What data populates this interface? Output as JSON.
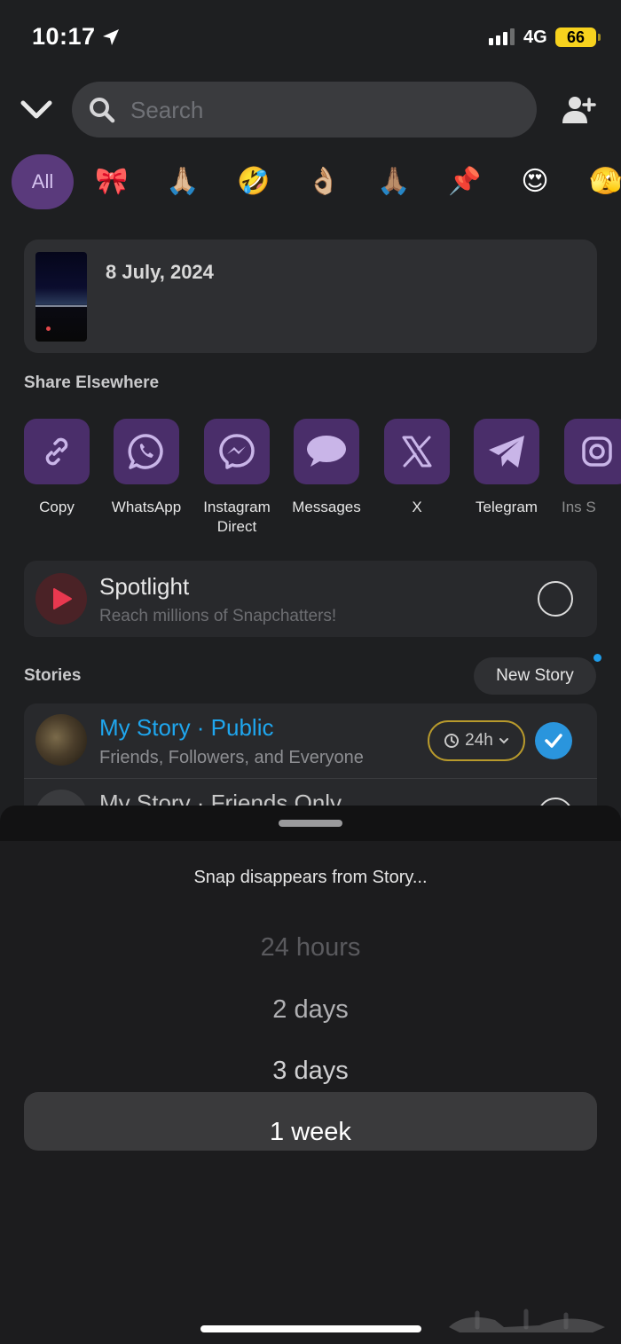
{
  "status_bar": {
    "time": "10:17",
    "network": "4G",
    "battery": "66"
  },
  "search": {
    "placeholder": "Search"
  },
  "filters": {
    "all_label": "All",
    "emojis": [
      "🎀",
      "🙏🏼",
      "🤣",
      "👌🏼",
      "🙏🏽",
      "📌",
      "😍",
      "🫣"
    ]
  },
  "snap": {
    "date": "8 July, 2024"
  },
  "share_elsewhere": {
    "title": "Share Elsewhere",
    "items": [
      {
        "label": "Copy",
        "icon": "link-icon"
      },
      {
        "label": "WhatsApp",
        "icon": "whatsapp-icon"
      },
      {
        "label": "Instagram Direct",
        "icon": "messenger-icon"
      },
      {
        "label": "Messages",
        "icon": "speech-bubble-icon"
      },
      {
        "label": "X",
        "icon": "x-icon"
      },
      {
        "label": "Telegram",
        "icon": "paper-plane-icon"
      },
      {
        "label": "Ins S",
        "icon": "instagram-icon"
      }
    ]
  },
  "spotlight": {
    "title": "Spotlight",
    "subtitle": "Reach millions of Snapchatters!"
  },
  "stories": {
    "title": "Stories",
    "new_story_label": "New Story",
    "items": [
      {
        "title": "My Story · Public",
        "subtitle": "Friends, Followers, and Everyone",
        "timer": "24h",
        "selected": true
      },
      {
        "title": "My Story · Friends Only",
        "selected": false
      }
    ]
  },
  "sheet": {
    "title": "Snap disappears from Story...",
    "options": [
      "24 hours",
      "2 days",
      "3 days",
      "1 week"
    ],
    "selected": "1 week"
  },
  "colors": {
    "accent_purple": "#4a2e6a",
    "story_blue": "#1fa6ee",
    "check_blue": "#2a95dd",
    "battery_yellow": "#f7d21e"
  }
}
